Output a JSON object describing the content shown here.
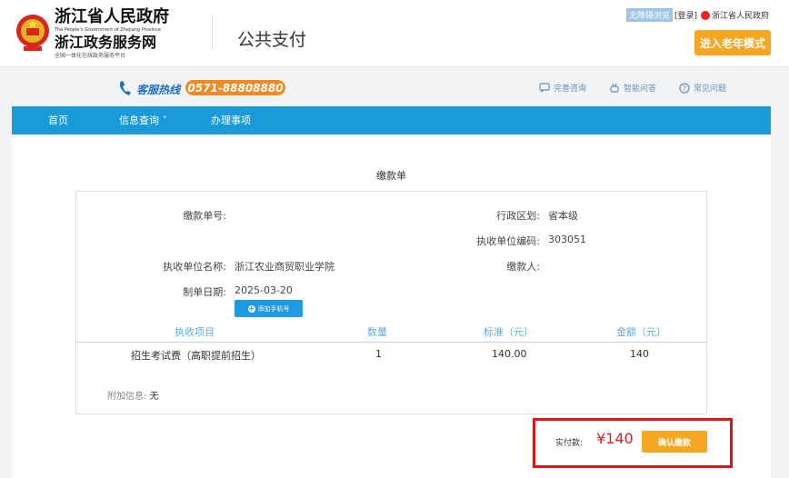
{
  "header": {
    "logo_line1": "浙江省人民政府",
    "logo_en": "The People's Government of Zhejiang Province",
    "logo_line2": "浙江政务服务网",
    "logo_sub": "全国一体化在线政务服务平台",
    "page_title": "公共支付",
    "accessible_label": "无障碍浏览",
    "login_label": "[登录]",
    "province_link": "浙江省人民政府",
    "elder_mode_label": "进入老年模式"
  },
  "hotline": {
    "label": "客服热线",
    "number": "0571-88808880",
    "links": [
      {
        "label": "完善咨询",
        "icon": "chat-icon"
      },
      {
        "label": "智能问答",
        "icon": "robot-icon"
      },
      {
        "label": "常见问题",
        "icon": "question-icon"
      }
    ]
  },
  "nav": {
    "items": [
      {
        "label": "首页"
      },
      {
        "label": "信息查询 ˅"
      },
      {
        "label": "办理事项"
      }
    ]
  },
  "bill": {
    "title": "缴款单",
    "fields": {
      "bill_no_label": "缴款单号:",
      "bill_no_value": "",
      "region_label": "行政区划:",
      "region_value": "省本级",
      "unit_code_label": "执收单位编码:",
      "unit_code_value": "303051",
      "unit_name_label": "执收单位名称:",
      "unit_name_value": "浙江农业商贸职业学院",
      "payer_label": "缴款人:",
      "payer_value": "",
      "date_label": "制单日期:",
      "date_value": "2025-03-20"
    },
    "add_phone_label": "添加手机号",
    "columns": [
      "执收项目",
      "数量",
      "标准（元）",
      "金额（元）"
    ],
    "rows": [
      {
        "item": "招生考试费（高职提前招生）",
        "qty": "1",
        "standard": "140.00",
        "amount": "140"
      }
    ],
    "extra_label": "附加信息:",
    "extra_value": "无"
  },
  "payment": {
    "label": "实付款:",
    "amount": "¥140",
    "confirm_label": "确认缴款",
    "highlight_color": "#e01616"
  },
  "colors": {
    "nav_bg": "#1a9ad6",
    "accent_orange": "#f5a623",
    "hotline_orange": "#f08a24"
  }
}
